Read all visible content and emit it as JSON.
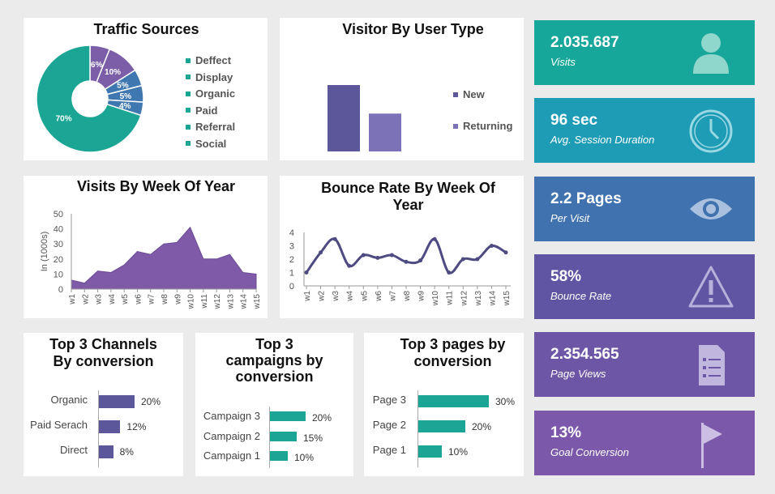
{
  "colors": {
    "teal": "#1aa595",
    "purple_dark": "#5b579a",
    "purple_mid": "#7b72b8",
    "purple_area": "#7e5aa8",
    "line": "#4e4a82",
    "kpi1": "#17a69a",
    "kpi2": "#1e9bb5",
    "kpi3": "#3f72ae",
    "kpi4": "#6055a3",
    "kpi5": "#6d56a6",
    "kpi6": "#7b58a9"
  },
  "traffic_sources": {
    "title": "Traffic Sources",
    "legend": [
      "Deffect",
      "Display",
      "Organic",
      "Paid",
      "Referral",
      "Social"
    ]
  },
  "visitor_type": {
    "title": "Visitor By User Type",
    "legend": [
      "New",
      "Returning"
    ]
  },
  "visits_week": {
    "title": "Visits By Week Of Year"
  },
  "bounce_week": {
    "title_line1": "Bounce Rate By Week Of",
    "title_line2": "Year"
  },
  "channels": {
    "title_line1": "Top 3 Channels",
    "title_line2": "By conversion"
  },
  "campaigns": {
    "title_line1": "Top 3",
    "title_line2": "campaigns by",
    "title_line3": "conversion"
  },
  "pages": {
    "title_line1": "Top 3 pages by",
    "title_line2": "conversion"
  },
  "kpis": [
    {
      "value": "2.035.687",
      "label": "Visits",
      "icon": "user-icon"
    },
    {
      "value": "96 sec",
      "label": "Avg. Session Duration",
      "icon": "clock-icon"
    },
    {
      "value": "2.2 Pages",
      "label": "Per Visit",
      "icon": "eye-icon"
    },
    {
      "value": "58%",
      "label": "Bounce Rate",
      "icon": "warning-icon"
    },
    {
      "value": "2.354.565",
      "label": "Page Views",
      "icon": "document-icon"
    },
    {
      "value": "13%",
      "label": "Goal Conversion",
      "icon": "flag-icon"
    }
  ],
  "chart_data": [
    {
      "type": "pie",
      "title": "Traffic Sources",
      "categories": [
        "Deffect",
        "Display",
        "Organic",
        "Paid",
        "Referral",
        "Social"
      ],
      "values": [
        6,
        10,
        5,
        5,
        4,
        70
      ],
      "labels": [
        "6%",
        "10%",
        "5%",
        "5%",
        "4%",
        "70%"
      ],
      "legend": "right"
    },
    {
      "type": "bar",
      "title": "Visitor By User Type",
      "categories": [
        "New",
        "Returning"
      ],
      "values": [
        100,
        57
      ],
      "legend": "right"
    },
    {
      "type": "area",
      "title": "Visits By Week Of Year",
      "ylabel": "In (1000s)",
      "categories": [
        "w1",
        "w2",
        "w3",
        "w4",
        "w5",
        "w6",
        "w7",
        "w8",
        "w9",
        "w10",
        "w11",
        "w12",
        "w13",
        "w14",
        "w15"
      ],
      "values": [
        6,
        4,
        12,
        11,
        16,
        25,
        23,
        30,
        31,
        41,
        20,
        20,
        23,
        11,
        10
      ],
      "ylim": [
        0,
        50
      ],
      "yticks": [
        0,
        10,
        20,
        30,
        40,
        50
      ]
    },
    {
      "type": "line",
      "title": "Bounce Rate By Week Of Year",
      "categories": [
        "w1",
        "w2",
        "w3",
        "w4",
        "w5",
        "w6",
        "w7",
        "w8",
        "w9",
        "w10",
        "w11",
        "w12",
        "w13",
        "w14",
        "w15"
      ],
      "values": [
        1,
        2.5,
        3.5,
        1.5,
        2.3,
        2.1,
        2.3,
        1.8,
        1.9,
        3.5,
        1,
        2,
        2,
        3,
        2.5
      ],
      "ylim": [
        0,
        4
      ],
      "yticks": [
        0,
        1,
        2,
        3,
        4
      ]
    },
    {
      "type": "bar",
      "orientation": "horizontal",
      "title": "Top 3 Channels By conversion",
      "categories": [
        "Organic",
        "Paid Serach",
        "Direct"
      ],
      "values": [
        20,
        12,
        8
      ],
      "labels": [
        "20%",
        "12%",
        "8%"
      ]
    },
    {
      "type": "bar",
      "orientation": "horizontal",
      "title": "Top 3 campaigns by conversion",
      "categories": [
        "Campaign 3",
        "Campaign 2",
        "Campaign 1"
      ],
      "values": [
        20,
        15,
        10
      ],
      "labels": [
        "20%",
        "15%",
        "10%"
      ]
    },
    {
      "type": "bar",
      "orientation": "horizontal",
      "title": "Top 3 pages by conversion",
      "categories": [
        "Page 3",
        "Page 2",
        "Page 1"
      ],
      "values": [
        30,
        20,
        10
      ],
      "labels": [
        "30%",
        "20%",
        "10%"
      ]
    }
  ]
}
